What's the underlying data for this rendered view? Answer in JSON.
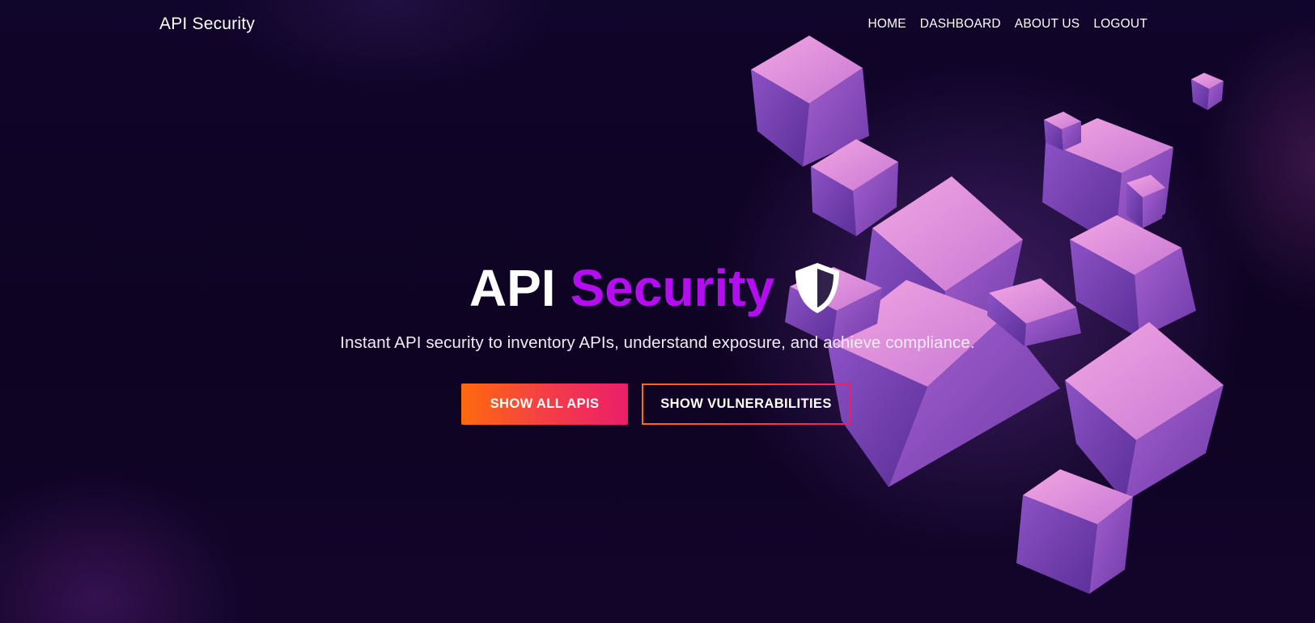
{
  "navbar": {
    "brand": "API Security",
    "links": [
      {
        "label": "HOME"
      },
      {
        "label": "DASHBOARD"
      },
      {
        "label": "ABOUT US"
      },
      {
        "label": "LOGOUT"
      }
    ]
  },
  "hero": {
    "title_part1": "API",
    "title_part2": "Security",
    "title_icon": "shield-icon",
    "subtitle": "Instant API security to inventory APIs, understand exposure, and achieve compliance.",
    "primary_button": "SHOW ALL APIS",
    "secondary_button": "SHOW VULNERABILITIES"
  },
  "colors": {
    "background": "#0f0424",
    "accent_purple": "#b40ef0",
    "button_gradient_start": "#ff6a0d",
    "button_gradient_end": "#ec1e6a",
    "cube_light": "#e58fd8",
    "cube_dark": "#6a3aa8"
  },
  "decoration": {
    "hero_art": "floating-3d-cubes"
  }
}
